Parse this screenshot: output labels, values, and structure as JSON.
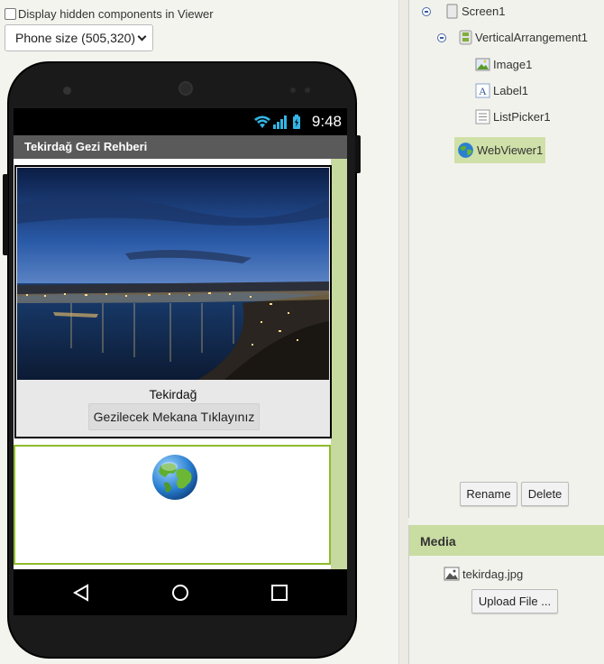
{
  "viewer": {
    "hidden_components_label": "Display hidden components in Viewer",
    "size_select": "Phone size (505,320)"
  },
  "phone": {
    "status_time": "9:48",
    "app_title": "Tekirdağ Gezi Rehberi",
    "label1_text": "Tekirdağ",
    "listpicker_text": "Gezilecek Mekana Tıklayınız"
  },
  "components": {
    "items": [
      {
        "name": "Screen1",
        "icon": "screen-icon"
      },
      {
        "name": "VerticalArrangement1",
        "icon": "vertical-arrangement-icon"
      },
      {
        "name": "Image1",
        "icon": "image-icon"
      },
      {
        "name": "Label1",
        "icon": "label-icon"
      },
      {
        "name": "ListPicker1",
        "icon": "listpicker-icon"
      },
      {
        "name": "WebViewer1",
        "icon": "webviewer-icon",
        "selected": true
      }
    ],
    "rename_label": "Rename",
    "delete_label": "Delete"
  },
  "media": {
    "title": "Media",
    "files": [
      "tekirdag.jpg"
    ],
    "upload_label": "Upload File ..."
  },
  "colors": {
    "selected_bg": "#cfe0a8",
    "media_header": "#c9dca2",
    "webviewer_border": "#8ebb2a"
  }
}
